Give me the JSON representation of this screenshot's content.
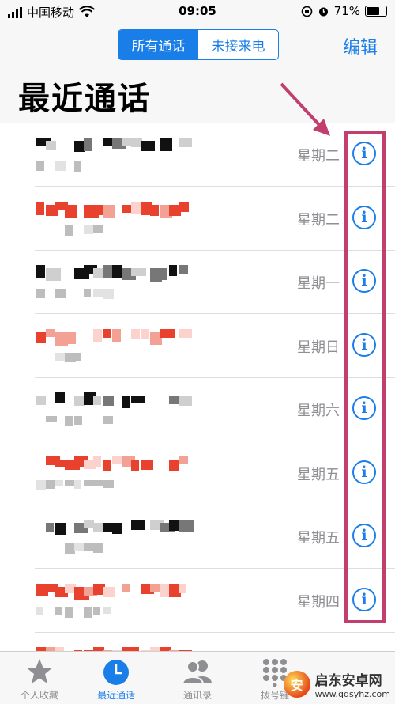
{
  "status_bar": {
    "carrier": "中国移动",
    "time": "09:05",
    "battery_percent": "71%",
    "battery_level": 0.71
  },
  "header": {
    "segments": [
      "所有通话",
      "未接来电"
    ],
    "active_segment": 0,
    "edit_label": "编辑",
    "title": "最近通话"
  },
  "calls": [
    {
      "day": "星期二",
      "missed": false
    },
    {
      "day": "星期二",
      "missed": true
    },
    {
      "day": "星期一",
      "missed": false
    },
    {
      "day": "星期日",
      "missed": true
    },
    {
      "day": "星期六",
      "missed": false
    },
    {
      "day": "星期五",
      "missed": true
    },
    {
      "day": "星期五",
      "missed": false
    },
    {
      "day": "星期四",
      "missed": true
    }
  ],
  "info_glyph": "i",
  "tabs": [
    {
      "label": "个人收藏",
      "icon": "star-icon",
      "active": false
    },
    {
      "label": "最近通话",
      "icon": "clock-icon",
      "active": true
    },
    {
      "label": "通讯录",
      "icon": "contacts-icon",
      "active": false
    },
    {
      "label": "拨号键",
      "icon": "keypad-icon",
      "active": false
    }
  ],
  "watermark": {
    "title": "启东安卓网",
    "url": "www.qdsyhz.com"
  },
  "colors": {
    "accent": "#1a7ee8",
    "missed": "#e8412e",
    "annotation": "#c23e6f"
  }
}
